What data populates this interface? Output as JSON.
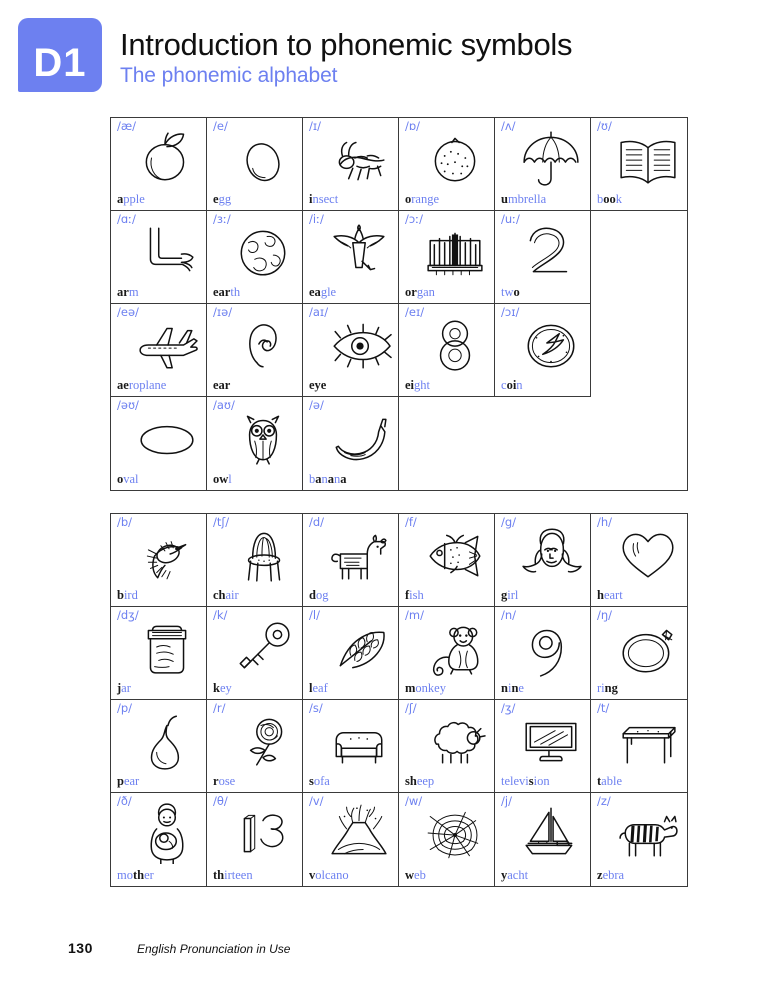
{
  "header": {
    "unit_code": "D1",
    "title": "Introduction to phonemic symbols",
    "subtitle": "The phonemic alphabet",
    "accent_color": "#6d80f0"
  },
  "footer": {
    "page_number": "130",
    "book_title": "English Pronunciation in Use"
  },
  "vowel_table": {
    "columns": 6,
    "cells": [
      {
        "symbol": "/æ/",
        "word": "apple",
        "highlight": "a",
        "picture": "apple",
        "pic_name": "apple-drawing"
      },
      {
        "symbol": "/e/",
        "word": "egg",
        "highlight": "e",
        "picture": "egg",
        "pic_name": "egg-drawing"
      },
      {
        "symbol": "/ɪ/",
        "word": "insect",
        "highlight": "i",
        "picture": "insect",
        "pic_name": "insect-drawing"
      },
      {
        "symbol": "/ɒ/",
        "word": "orange",
        "highlight": "o",
        "picture": "orange",
        "pic_name": "orange-drawing"
      },
      {
        "symbol": "/ʌ/",
        "word": "umbrella",
        "highlight": "u",
        "picture": "umbrella",
        "pic_name": "umbrella-drawing"
      },
      {
        "symbol": "/ʊ/",
        "word": "book",
        "highlight": "oo",
        "picture": "book",
        "pic_name": "book-drawing"
      },
      {
        "symbol": "/ɑː/",
        "word": "arm",
        "highlight": "ar",
        "picture": "arm",
        "pic_name": "arm-drawing"
      },
      {
        "symbol": "/ɜː/",
        "word": "earth",
        "highlight": "ear",
        "picture": "earth",
        "pic_name": "earth-drawing"
      },
      {
        "symbol": "/iː/",
        "word": "eagle",
        "highlight": "ea",
        "picture": "eagle",
        "pic_name": "eagle-drawing"
      },
      {
        "symbol": "/ɔː/",
        "word": "organ",
        "highlight": "or",
        "picture": "organ",
        "pic_name": "organ-drawing"
      },
      {
        "symbol": "/uː/",
        "word": "two",
        "highlight": "o",
        "picture": "two",
        "pic_name": "number-two-drawing"
      },
      {
        "symbol": "",
        "word": "",
        "highlight": "",
        "picture": "",
        "pic_name": ""
      },
      {
        "symbol": "/eə/",
        "word": "aeroplane",
        "highlight": "ae",
        "picture": "aeroplane",
        "pic_name": "aeroplane-drawing"
      },
      {
        "symbol": "/ɪə/",
        "word": "ear",
        "highlight": "ear",
        "picture": "ear",
        "pic_name": "ear-drawing"
      },
      {
        "symbol": "/aɪ/",
        "word": "eye",
        "highlight": "eye",
        "picture": "eye",
        "pic_name": "eye-drawing"
      },
      {
        "symbol": "/eɪ/",
        "word": "eight",
        "highlight": "ei",
        "picture": "eight",
        "pic_name": "number-eight-drawing"
      },
      {
        "symbol": "/ɔɪ/",
        "word": "coin",
        "highlight": "oi",
        "picture": "coin",
        "pic_name": "coin-drawing"
      },
      {
        "symbol": "",
        "word": "",
        "highlight": "",
        "picture": "",
        "pic_name": ""
      },
      {
        "symbol": "/əʊ/",
        "word": "oval",
        "highlight": "o",
        "picture": "oval",
        "pic_name": "oval-drawing"
      },
      {
        "symbol": "/aʊ/",
        "word": "owl",
        "highlight": "ow",
        "picture": "owl",
        "pic_name": "owl-drawing"
      },
      {
        "symbol": "/ə/",
        "word": "banana",
        "highlight": "a",
        "picture": "banana",
        "pic_name": "banana-drawing"
      },
      {
        "symbol": "",
        "word": "",
        "highlight": "",
        "picture": "",
        "pic_name": ""
      },
      {
        "symbol": "",
        "word": "",
        "highlight": "",
        "picture": "",
        "pic_name": ""
      },
      {
        "symbol": "",
        "word": "",
        "highlight": "",
        "picture": "",
        "pic_name": ""
      }
    ]
  },
  "consonant_table": {
    "columns": 6,
    "cells": [
      {
        "symbol": "/b/",
        "word": "bird",
        "highlight": "b",
        "picture": "bird",
        "pic_name": "bird-drawing"
      },
      {
        "symbol": "/tʃ/",
        "word": "chair",
        "highlight": "ch",
        "picture": "chair",
        "pic_name": "chair-drawing"
      },
      {
        "symbol": "/d/",
        "word": "dog",
        "highlight": "d",
        "picture": "dog",
        "pic_name": "dog-drawing"
      },
      {
        "symbol": "/f/",
        "word": "fish",
        "highlight": "f",
        "picture": "fish",
        "pic_name": "fish-drawing"
      },
      {
        "symbol": "/g/",
        "word": "girl",
        "highlight": "g",
        "picture": "girl",
        "pic_name": "girl-drawing"
      },
      {
        "symbol": "/h/",
        "word": "heart",
        "highlight": "h",
        "picture": "heart",
        "pic_name": "heart-drawing"
      },
      {
        "symbol": "/dʒ/",
        "word": "jar",
        "highlight": "j",
        "picture": "jar",
        "pic_name": "jar-drawing"
      },
      {
        "symbol": "/k/",
        "word": "key",
        "highlight": "k",
        "picture": "key",
        "pic_name": "key-drawing"
      },
      {
        "symbol": "/l/",
        "word": "leaf",
        "highlight": "l",
        "picture": "leaf",
        "pic_name": "leaf-drawing"
      },
      {
        "symbol": "/m/",
        "word": "monkey",
        "highlight": "m",
        "picture": "monkey",
        "pic_name": "monkey-drawing"
      },
      {
        "symbol": "/n/",
        "word": "nine",
        "highlight": "n",
        "picture": "nine",
        "pic_name": "number-nine-drawing"
      },
      {
        "symbol": "/ŋ/",
        "word": "ring",
        "highlight": "ng",
        "picture": "ring",
        "pic_name": "ring-drawing"
      },
      {
        "symbol": "/p/",
        "word": "pear",
        "highlight": "p",
        "picture": "pear",
        "pic_name": "pear-drawing"
      },
      {
        "symbol": "/r/",
        "word": "rose",
        "highlight": "r",
        "picture": "rose",
        "pic_name": "rose-drawing"
      },
      {
        "symbol": "/s/",
        "word": "sofa",
        "highlight": "s",
        "picture": "sofa",
        "pic_name": "sofa-drawing"
      },
      {
        "symbol": "/ʃ/",
        "word": "sheep",
        "highlight": "sh",
        "picture": "sheep",
        "pic_name": "sheep-drawing"
      },
      {
        "symbol": "/ʒ/",
        "word": "television",
        "highlight": "s",
        "picture": "television",
        "pic_name": "television-drawing"
      },
      {
        "symbol": "/t/",
        "word": "table",
        "highlight": "t",
        "picture": "table",
        "pic_name": "table-drawing"
      },
      {
        "symbol": "/ð/",
        "word": "mother",
        "highlight": "th",
        "picture": "mother",
        "pic_name": "mother-drawing"
      },
      {
        "symbol": "/θ/",
        "word": "thirteen",
        "highlight": "th",
        "picture": "thirteen",
        "pic_name": "number-thirteen-drawing"
      },
      {
        "symbol": "/v/",
        "word": "volcano",
        "highlight": "v",
        "picture": "volcano",
        "pic_name": "volcano-drawing"
      },
      {
        "symbol": "/w/",
        "word": "web",
        "highlight": "w",
        "picture": "web",
        "pic_name": "web-drawing"
      },
      {
        "symbol": "/j/",
        "word": "yacht",
        "highlight": "y",
        "picture": "yacht",
        "pic_name": "yacht-drawing"
      },
      {
        "symbol": "/z/",
        "word": "zebra",
        "highlight": "z",
        "picture": "zebra",
        "pic_name": "zebra-drawing"
      }
    ]
  }
}
